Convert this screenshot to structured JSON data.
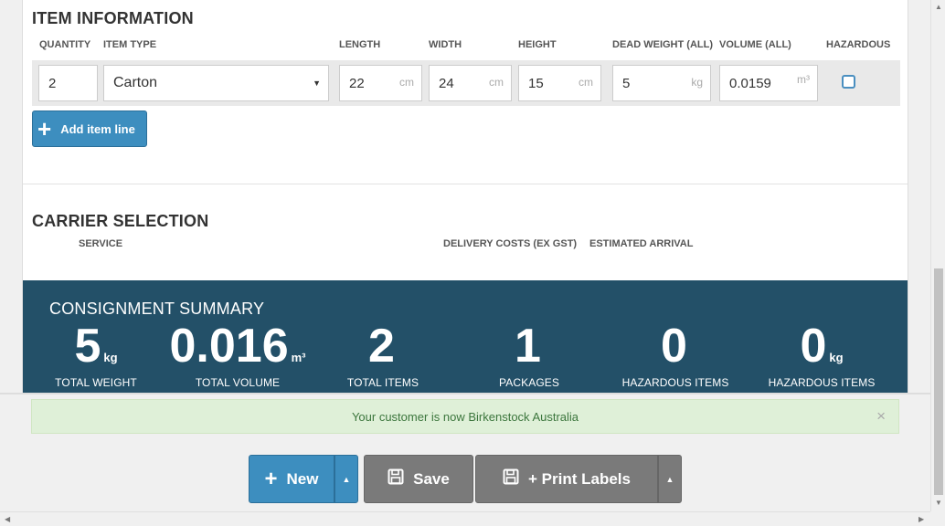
{
  "item_section": {
    "title": "ITEM INFORMATION",
    "columns": {
      "quantity": "QUANTITY",
      "item_type": "ITEM TYPE",
      "length": "LENGTH",
      "width": "WIDTH",
      "height": "HEIGHT",
      "dead_weight": "DEAD WEIGHT (ALL)",
      "volume": "VOLUME (ALL)",
      "hazardous": "HAZARDOUS"
    },
    "row": {
      "quantity": "2",
      "item_type": "Carton",
      "length": "22",
      "length_unit": "cm",
      "width": "24",
      "width_unit": "cm",
      "height": "15",
      "height_unit": "cm",
      "dead_weight": "5",
      "dead_weight_unit": "kg",
      "volume": "0.0159",
      "volume_unit": "m³",
      "hazardous_checked": false
    },
    "add_line_label": "Add item line"
  },
  "carrier_section": {
    "title": "CARRIER SELECTION",
    "columns": {
      "service": "SERVICE",
      "delivery_costs": "DELIVERY COSTS (EX GST)",
      "estimated_arrival": "ESTIMATED ARRIVAL"
    }
  },
  "summary": {
    "title": "CONSIGNMENT SUMMARY",
    "stats": [
      {
        "value": "5",
        "suffix": "kg",
        "label": "TOTAL WEIGHT"
      },
      {
        "value": "0.016",
        "suffix": "m³",
        "label": "TOTAL VOLUME"
      },
      {
        "value": "2",
        "suffix": "",
        "label": "TOTAL ITEMS"
      },
      {
        "value": "1",
        "suffix": "",
        "label": "PACKAGES"
      },
      {
        "value": "0",
        "suffix": "",
        "label": "HAZARDOUS ITEMS"
      },
      {
        "value": "0",
        "suffix": "kg",
        "label": "HAZARDOUS ITEMS"
      }
    ]
  },
  "alert": {
    "message": "Your customer is now Birkenstock Australia",
    "close_symbol": "×"
  },
  "actions": {
    "new_label": "New",
    "save_label": "Save",
    "print_label": "+ Print Labels"
  },
  "colors": {
    "accent": "#3d8ebf",
    "summary_bg": "#235068",
    "alert_bg": "#dff0d8",
    "alert_text": "#3c763d",
    "secondary_button": "#7a7a7a"
  }
}
